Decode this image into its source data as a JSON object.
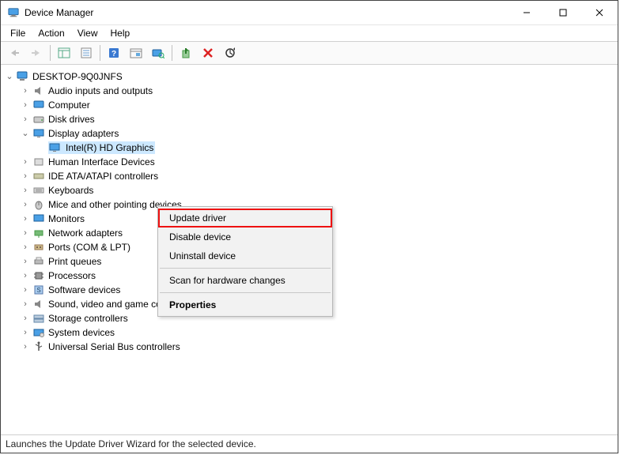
{
  "window": {
    "title": "Device Manager"
  },
  "menubar": {
    "items": [
      "File",
      "Action",
      "View",
      "Help"
    ]
  },
  "toolbar": {
    "buttons": [
      {
        "name": "back-icon",
        "enabled": false
      },
      {
        "name": "forward-icon",
        "enabled": false
      },
      {
        "name": "sep"
      },
      {
        "name": "show-hide-console-tree-icon",
        "enabled": true
      },
      {
        "name": "properties-sheet-icon",
        "enabled": true
      },
      {
        "name": "sep"
      },
      {
        "name": "help-icon",
        "enabled": true
      },
      {
        "name": "show-hidden-icon",
        "enabled": true
      },
      {
        "name": "scan-hardware-icon",
        "enabled": true
      },
      {
        "name": "sep"
      },
      {
        "name": "update-driver-icon",
        "enabled": true
      },
      {
        "name": "uninstall-device-icon",
        "enabled": true
      },
      {
        "name": "scan-changes-icon",
        "enabled": true
      }
    ]
  },
  "tree": {
    "root": {
      "label": "DESKTOP-9Q0JNFS",
      "expanded": true,
      "icon": "computer"
    },
    "items": [
      {
        "label": "Audio inputs and outputs",
        "expanded": false,
        "icon": "audio"
      },
      {
        "label": "Computer",
        "expanded": false,
        "icon": "computer"
      },
      {
        "label": "Disk drives",
        "expanded": false,
        "icon": "disk"
      },
      {
        "label": "Display adapters",
        "expanded": true,
        "icon": "display",
        "children": [
          {
            "label": "Intel(R) HD Graphics",
            "icon": "display",
            "selected": true
          }
        ]
      },
      {
        "label": "Human Interface Devices",
        "expanded": false,
        "icon": "hid"
      },
      {
        "label": "IDE ATA/ATAPI controllers",
        "expanded": false,
        "icon": "ide"
      },
      {
        "label": "Keyboards",
        "expanded": false,
        "icon": "keyboard"
      },
      {
        "label": "Mice and other pointing devices",
        "expanded": false,
        "icon": "mouse"
      },
      {
        "label": "Monitors",
        "expanded": false,
        "icon": "display"
      },
      {
        "label": "Network adapters",
        "expanded": false,
        "icon": "network"
      },
      {
        "label": "Ports (COM & LPT)",
        "expanded": false,
        "icon": "port"
      },
      {
        "label": "Print queues",
        "expanded": false,
        "icon": "printer"
      },
      {
        "label": "Processors",
        "expanded": false,
        "icon": "cpu"
      },
      {
        "label": "Software devices",
        "expanded": false,
        "icon": "software"
      },
      {
        "label": "Sound, video and game controllers",
        "expanded": false,
        "icon": "audio"
      },
      {
        "label": "Storage controllers",
        "expanded": false,
        "icon": "storage"
      },
      {
        "label": "System devices",
        "expanded": false,
        "icon": "system"
      },
      {
        "label": "Universal Serial Bus controllers",
        "expanded": false,
        "icon": "usb"
      }
    ]
  },
  "context_menu": {
    "items": [
      {
        "label": "Update driver",
        "highlight": true
      },
      {
        "label": "Disable device"
      },
      {
        "label": "Uninstall device"
      },
      {
        "sep": true
      },
      {
        "label": "Scan for hardware changes"
      },
      {
        "sep": true
      },
      {
        "label": "Properties",
        "bold": true
      }
    ]
  },
  "status": {
    "text": "Launches the Update Driver Wizard for the selected device."
  }
}
